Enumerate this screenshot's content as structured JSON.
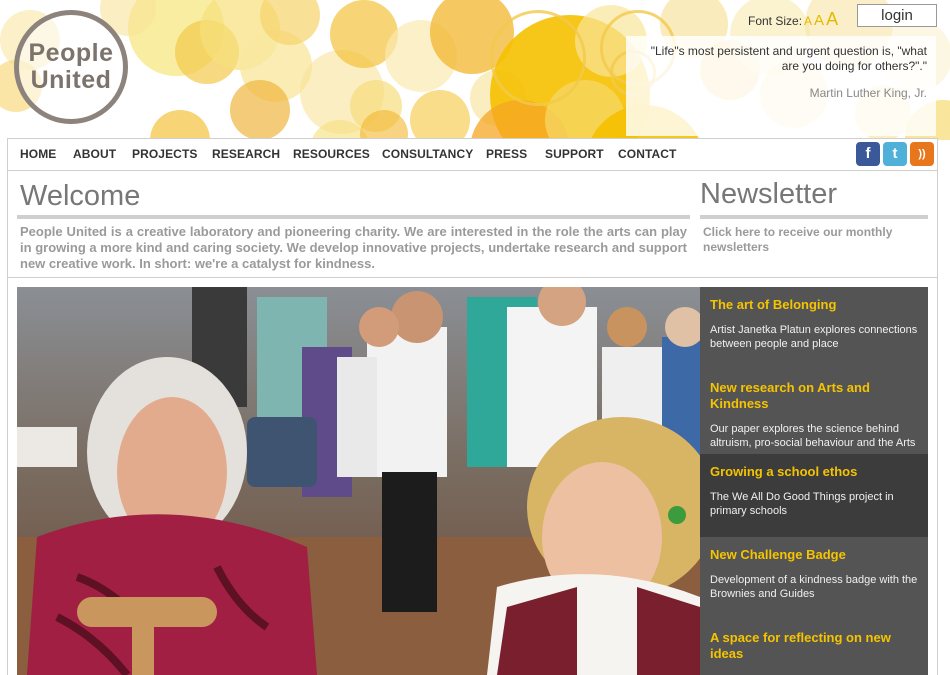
{
  "header": {
    "logo_line1": "People",
    "logo_line2": "United",
    "font_size_label": "Font Size:",
    "font_size_options": [
      "A",
      "A",
      "A"
    ],
    "login_label": "login",
    "quote_text": "\"Life\"s most persistent and urgent question is, \"what are you doing for others?\".\"",
    "quote_author": "Martin Luther King, Jr."
  },
  "nav": {
    "items": [
      "HOME",
      "ABOUT",
      "PROJECTS",
      "RESEARCH",
      "RESOURCES",
      "CONSULTANCY",
      "PRESS",
      "SUPPORT",
      "CONTACT"
    ],
    "social": [
      {
        "icon": "facebook-icon",
        "glyph": "f",
        "color": "#3b5998"
      },
      {
        "icon": "twitter-icon",
        "glyph": "t",
        "color": "#4fb0d8"
      },
      {
        "icon": "rss-icon",
        "glyph": "))",
        "color": "#e8761c"
      }
    ]
  },
  "welcome": {
    "title": "Welcome",
    "text": "People United is a creative laboratory and pioneering charity. We are interested in the role the arts can play in growing a more kind and caring society. We develop innovative projects, undertake research and support new creative work. In short: we're a catalyst for kindness."
  },
  "newsletter": {
    "title": "Newsletter",
    "link_text": "Click here to receive our monthly newsletters"
  },
  "stories": [
    {
      "title": "The art of Belonging",
      "desc": "Artist Janetka Platun explores connections between people and place"
    },
    {
      "title": "New research on Arts and Kindness",
      "desc": "Our paper explores the science behind altruism, pro-social behaviour and the Arts"
    },
    {
      "title": "Growing a school ethos",
      "desc": "The We All Do Good Things project in primary schools"
    },
    {
      "title": "New Challenge Badge",
      "desc": "Development of a kindness badge with the Brownies and Guides"
    },
    {
      "title": "A space for reflecting on new ideas",
      "desc": ""
    }
  ],
  "colors": {
    "accent_yellow": "#f5c400",
    "panel_bg": "#545454",
    "panel_active_bg": "#3c3c3c",
    "text_grey": "#9a9a9a"
  }
}
